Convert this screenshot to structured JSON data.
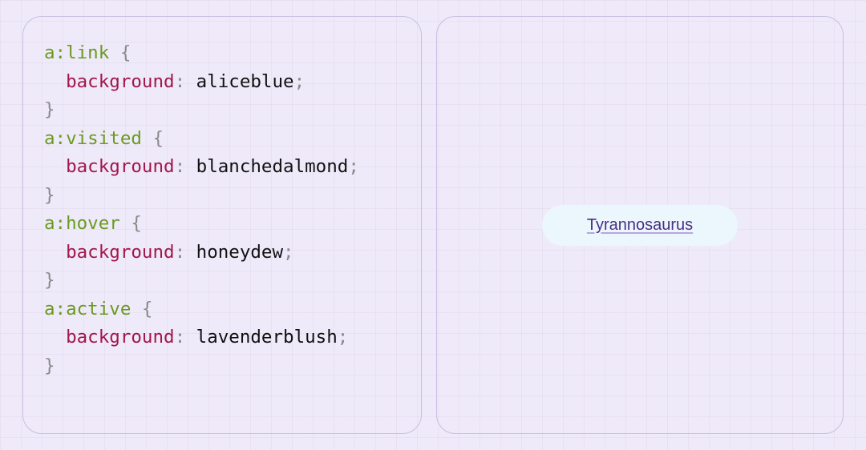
{
  "code": {
    "rules": [
      {
        "selector": "a:link",
        "property": "background",
        "value": "aliceblue"
      },
      {
        "selector": "a:visited",
        "property": "background",
        "value": "blanchedalmond"
      },
      {
        "selector": "a:hover",
        "property": "background",
        "value": "honeydew"
      },
      {
        "selector": "a:active",
        "property": "background",
        "value": "lavenderblush"
      }
    ]
  },
  "preview": {
    "link_text": "Tyrannosaurus",
    "link_background_color": "aliceblue"
  },
  "colors": {
    "page_bg": "#efeaf9",
    "panel_border": "#c8bee0",
    "syntax_selector": "#6a9a1f",
    "syntax_property": "#a2164b",
    "syntax_punct": "#8a8a8a",
    "link_color": "#4b2e83"
  }
}
